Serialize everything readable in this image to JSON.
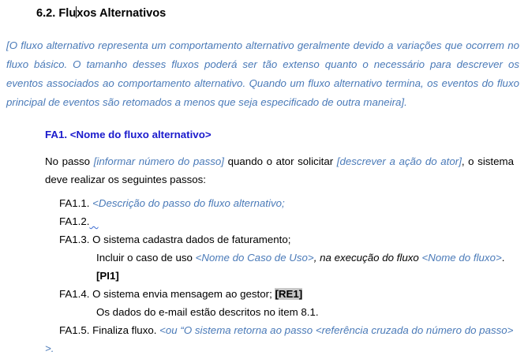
{
  "heading": {
    "text_before": "6.2. Flu",
    "text_after": "xos Alternativos"
  },
  "intro_paragraph": "[O fluxo alternativo representa um comportamento alternativo geralmente devido a variações que ocorrem no fluxo básico. O tamanho desses fluxos poderá ser tão extenso quanto o necessário para descrever os eventos associados ao comportamento alternativo. Quando um fluxo alternativo termina, os eventos do fluxo principal de eventos são retomados a menos que seja especificado de outra maneira].",
  "fa_title": "FA1. <Nome do fluxo alternativo>",
  "passo": {
    "t1": "No passo ",
    "i1": "[informar número do passo]",
    "t2": " quando o ator solicitar ",
    "i2": "[descrever a ação do ator]",
    "t3": ", o sistema deve realizar os seguintes passos:"
  },
  "steps": {
    "s1": {
      "label": "FA1.1. ",
      "text": "<Descrição do passo do fluxo alternativo;"
    },
    "s2": {
      "label": "FA1.2.",
      "mark": "..."
    },
    "s3": {
      "label": "FA1.3. ",
      "text": "O sistema cadastra dados de faturamento;"
    },
    "s3_sub": {
      "t1": "Incluir o caso de uso ",
      "i1": "<Nome do Caso de Uso>",
      "t2": ", na execução do fluxo ",
      "i2": "<Nome do fluxo>",
      "t3": "."
    },
    "s3_tag": "[PI1]",
    "s4": {
      "label": "FA1.4. ",
      "text": "O sistema envia mensagem ao gestor; ",
      "tag": "[RE1]"
    },
    "s4_sub": "Os dados do e-mail estão descritos no item 8.1.",
    "s5": {
      "label": "FA1.5. ",
      "text": "Finaliza fluxo. ",
      "i1": "<ou “O sistema retorna ao passo <referência cruzada do número do passo>",
      "i1_cont": ">."
    }
  }
}
